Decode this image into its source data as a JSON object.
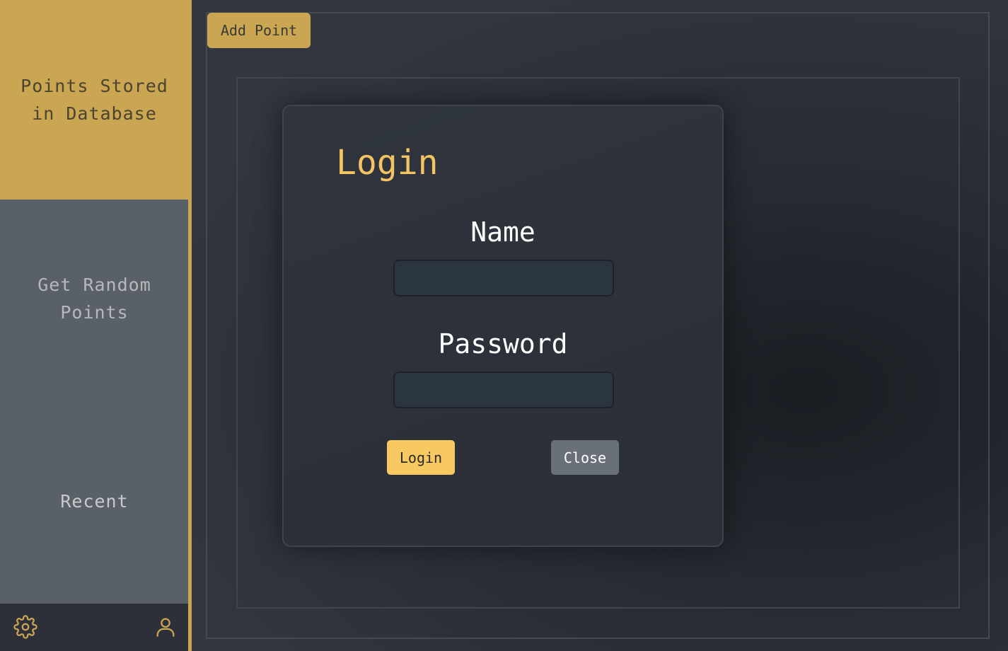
{
  "sidebar": {
    "items": [
      {
        "label": "Points Stored in Database",
        "active": true
      },
      {
        "label": "Get Random Points",
        "active": false
      },
      {
        "label": "Recent",
        "active": false
      }
    ],
    "footer": {
      "left_icon": "gear-icon",
      "right_icon": "user-icon"
    }
  },
  "main": {
    "add_point_label": "Add Point"
  },
  "modal": {
    "title": "Login",
    "name_label": "Name",
    "name_value": "",
    "password_label": "Password",
    "password_value": "",
    "login_label": "Login",
    "close_label": "Close"
  },
  "colors": {
    "accent": "#caa652",
    "title": "#f5c462",
    "login_button": "#f8c960",
    "close_button": "#6a7078",
    "sidebar_bg": "#5a6068"
  }
}
